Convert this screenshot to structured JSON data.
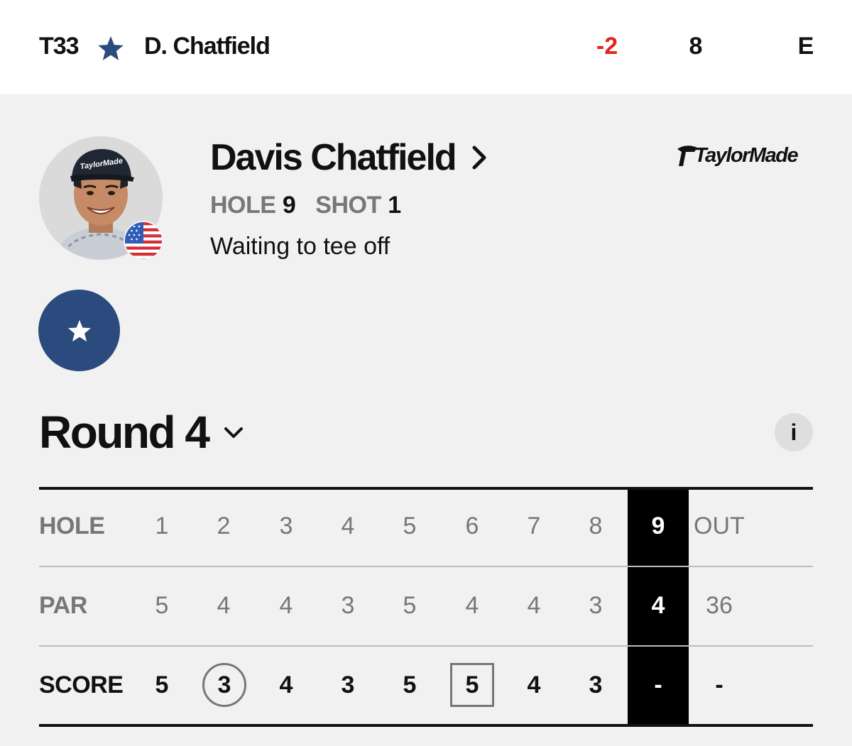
{
  "leaderboard_row": {
    "position": "T33",
    "name": "D. Chatfield",
    "total": "-2",
    "thru": "8",
    "today": "E",
    "accent_red": "#e1251b",
    "star_color": "#2b4a7e"
  },
  "player": {
    "name": "Davis Chatfield",
    "hole_label": "HOLE",
    "hole_value": "9",
    "shot_label": "SHOT",
    "shot_value": "1",
    "status": "Waiting to tee off",
    "country_flag": "usa-flag",
    "sponsor": "TaylorMade"
  },
  "favorite": {
    "icon": "star-icon",
    "color": "#2b4a7e"
  },
  "round": {
    "title": "Round 4",
    "info_label": "i"
  },
  "scorecard": {
    "hole_label": "HOLE",
    "par_label": "PAR",
    "score_label": "SCORE",
    "holes": [
      "1",
      "2",
      "3",
      "4",
      "5",
      "6",
      "7",
      "8",
      "9"
    ],
    "pars": [
      "5",
      "4",
      "4",
      "3",
      "5",
      "4",
      "4",
      "3",
      "4"
    ],
    "scores": [
      "5",
      "3",
      "4",
      "3",
      "5",
      "5",
      "4",
      "3",
      "-"
    ],
    "out_label": "OUT",
    "out_par": "36",
    "out_score": "-",
    "current_hole": "9",
    "score_marks": {
      "2": "birdie-circle",
      "6": "bogey-square"
    }
  }
}
